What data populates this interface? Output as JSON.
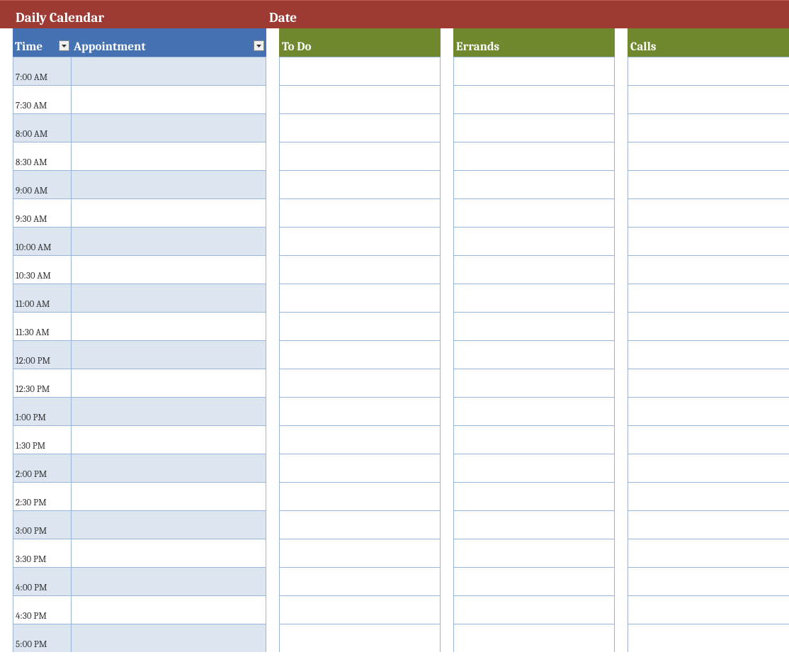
{
  "titleLeft": "Daily Calendar",
  "titleRight": "Date",
  "headers": {
    "time": "Time",
    "appointment": "Appointment"
  },
  "columns": [
    "To Do",
    "Errands",
    "Calls"
  ],
  "slots": [
    "7:00 AM",
    "7:30 AM",
    "8:00 AM",
    "8:30 AM",
    "9:00 AM",
    "9:30 AM",
    "10:00 AM",
    "10:30 AM",
    "11:00 AM",
    "11:30 AM",
    "12:00 PM",
    "12:30 PM",
    "1:00 PM",
    "1:30 PM",
    "2:00 PM",
    "2:30 PM",
    "3:00 PM",
    "3:30 PM",
    "4:00 PM",
    "4:30 PM",
    "5:00 PM"
  ],
  "appointments": [
    "",
    "",
    "",
    "",
    "",
    "",
    "",
    "",
    "",
    "",
    "",
    "",
    "",
    "",
    "",
    "",
    "",
    "",
    "",
    "",
    ""
  ],
  "todo": [
    "",
    "",
    "",
    "",
    "",
    "",
    "",
    "",
    "",
    "",
    "",
    "",
    "",
    "",
    "",
    "",
    "",
    "",
    "",
    "",
    ""
  ],
  "errands": [
    "",
    "",
    "",
    "",
    "",
    "",
    "",
    "",
    "",
    "",
    "",
    "",
    "",
    "",
    "",
    "",
    "",
    "",
    "",
    "",
    ""
  ],
  "calls": [
    "",
    "",
    "",
    "",
    "",
    "",
    "",
    "",
    "",
    "",
    "",
    "",
    "",
    "",
    "",
    "",
    "",
    "",
    "",
    "",
    ""
  ]
}
